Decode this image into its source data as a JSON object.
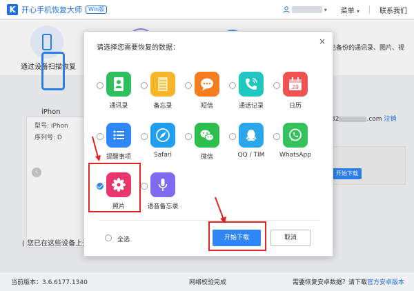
{
  "titlebar": {
    "logo": "K",
    "app_title": "开心手机恢复大师",
    "badge": "Win版",
    "menu_label": "菜单",
    "menu_caret": "▾",
    "contact_label": "联系我们",
    "user_caret": "▾"
  },
  "mode_bar": {
    "scan_label": "通过设备扫描恢复",
    "right_text": "已备份的通讯录、图片、视"
  },
  "device": {
    "name": "iPhon",
    "model_label": "型号: iPhon",
    "serial_label": "序列号: D",
    "hint": "( 您已在这些设备上开"
  },
  "right_panel": {
    "email_prefix": "82",
    "email_suffix": ".com",
    "logout": "注销",
    "download_label": "开始下载"
  },
  "statusbar": {
    "version": "当前版本：3.6.6177.1340",
    "network": "网络校验完成",
    "android_prefix": "需要恢复安卓数据？请下载",
    "android_link": "官方安卓版本"
  },
  "dialog": {
    "title": "请选择您需要恢复的数据：",
    "close": "×",
    "items": [
      {
        "label": "通讯录",
        "icon": "contacts-icon",
        "color": "#2fbf5e",
        "checked": false
      },
      {
        "label": "备忘录",
        "icon": "notes-icon",
        "color": "#f5b62a",
        "checked": false
      },
      {
        "label": "短信",
        "icon": "sms-icon",
        "color": "#f57c1f",
        "checked": false
      },
      {
        "label": "通话记录",
        "icon": "call-log-icon",
        "color": "#20c7c0",
        "checked": false
      },
      {
        "label": "日历",
        "icon": "calendar-icon",
        "color": "#f05252",
        "checked": false
      },
      {
        "label": "提醒事项",
        "icon": "reminders-icon",
        "color": "#2f86f6",
        "checked": false
      },
      {
        "label": "Safari",
        "icon": "safari-icon",
        "color": "#1e9ff2",
        "checked": false
      },
      {
        "label": "微信",
        "icon": "wechat-icon",
        "color": "#2dbf4d",
        "checked": false
      },
      {
        "label": "QQ / TIM",
        "icon": "qq-icon",
        "color": "#2aa7ec",
        "checked": false
      },
      {
        "label": "WhatsApp",
        "icon": "whatsapp-icon",
        "color": "#34c35a",
        "checked": false
      },
      {
        "label": "照片",
        "icon": "photos-icon",
        "color": "#e8376c",
        "checked": true
      },
      {
        "label": "语音备忘录",
        "icon": "voice-memo-icon",
        "color": "#7d6cf0",
        "checked": false
      }
    ],
    "calendar_day": "29",
    "select_all": "全选",
    "start_download": "开始下载",
    "cancel": "取消"
  }
}
